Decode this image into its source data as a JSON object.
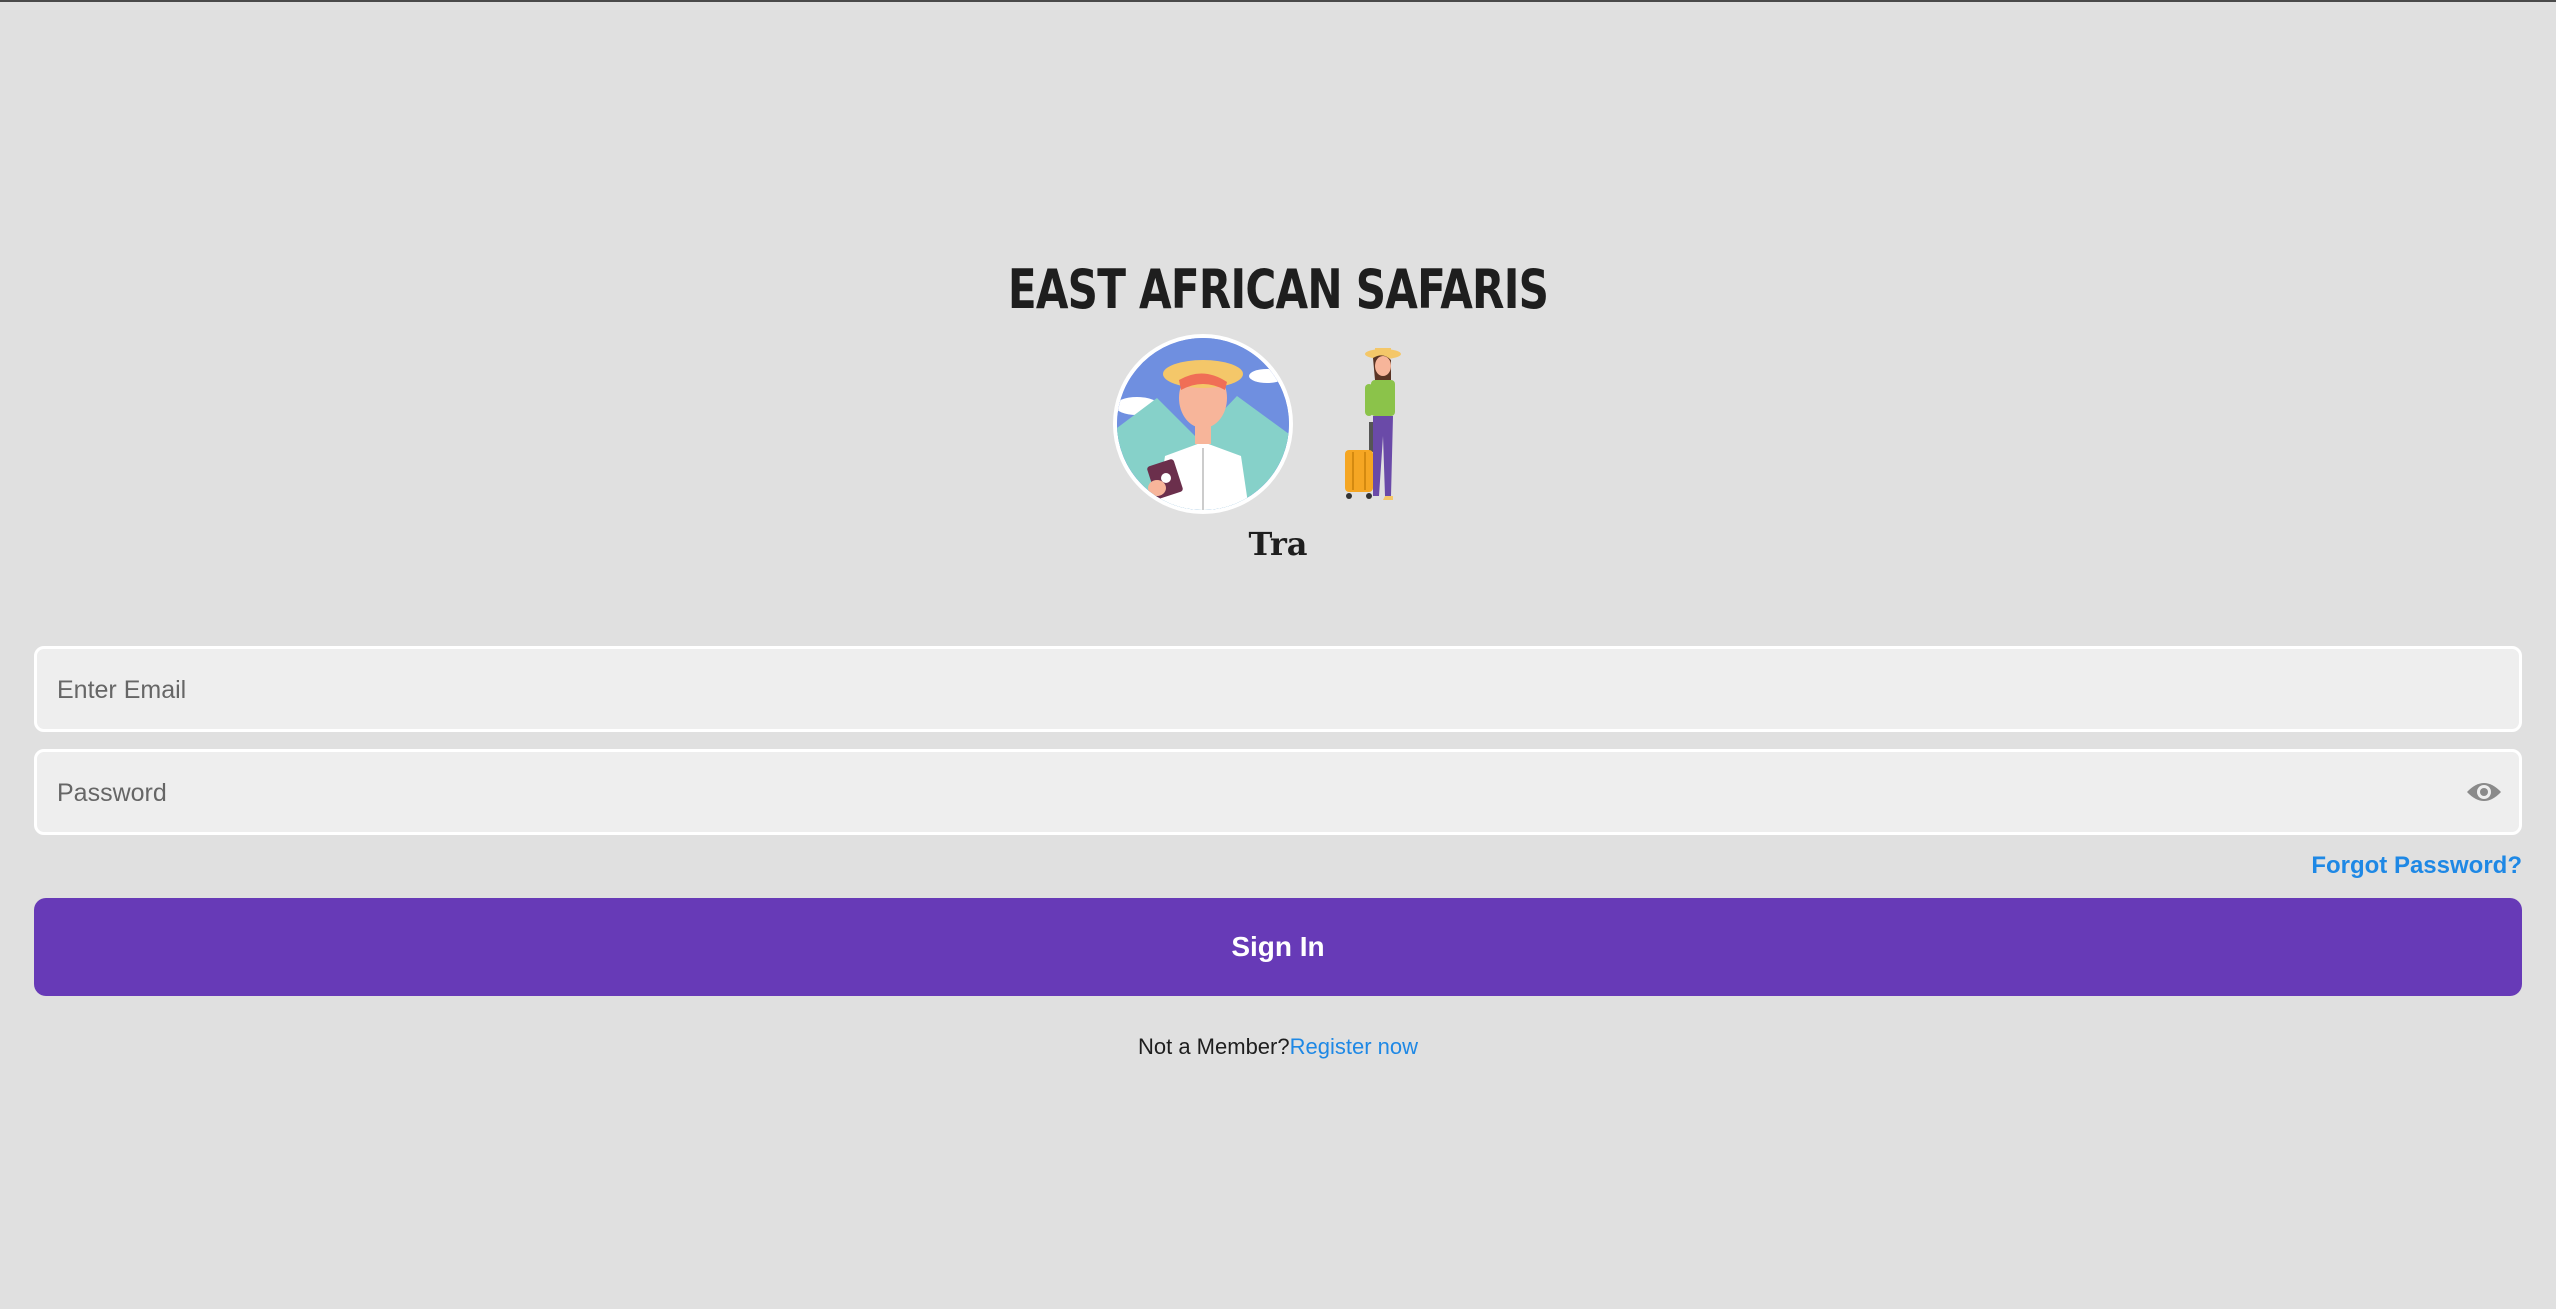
{
  "header": {
    "title": "EAST AFRICAN SAFARIS",
    "subtitle": "Tra"
  },
  "form": {
    "email_placeholder": "Enter Email",
    "password_placeholder": "Password",
    "forgot_password": "Forgot Password?",
    "sign_in": "Sign In",
    "not_member": "Not a Member?",
    "register": "Register now"
  },
  "icons": {
    "avatar": "traveler-man-avatar-icon",
    "traveler": "traveler-woman-suitcase-icon",
    "eye": "eye-icon"
  },
  "colors": {
    "background": "#e0e0e0",
    "accent": "#673ab7",
    "link": "#1e88e5"
  }
}
